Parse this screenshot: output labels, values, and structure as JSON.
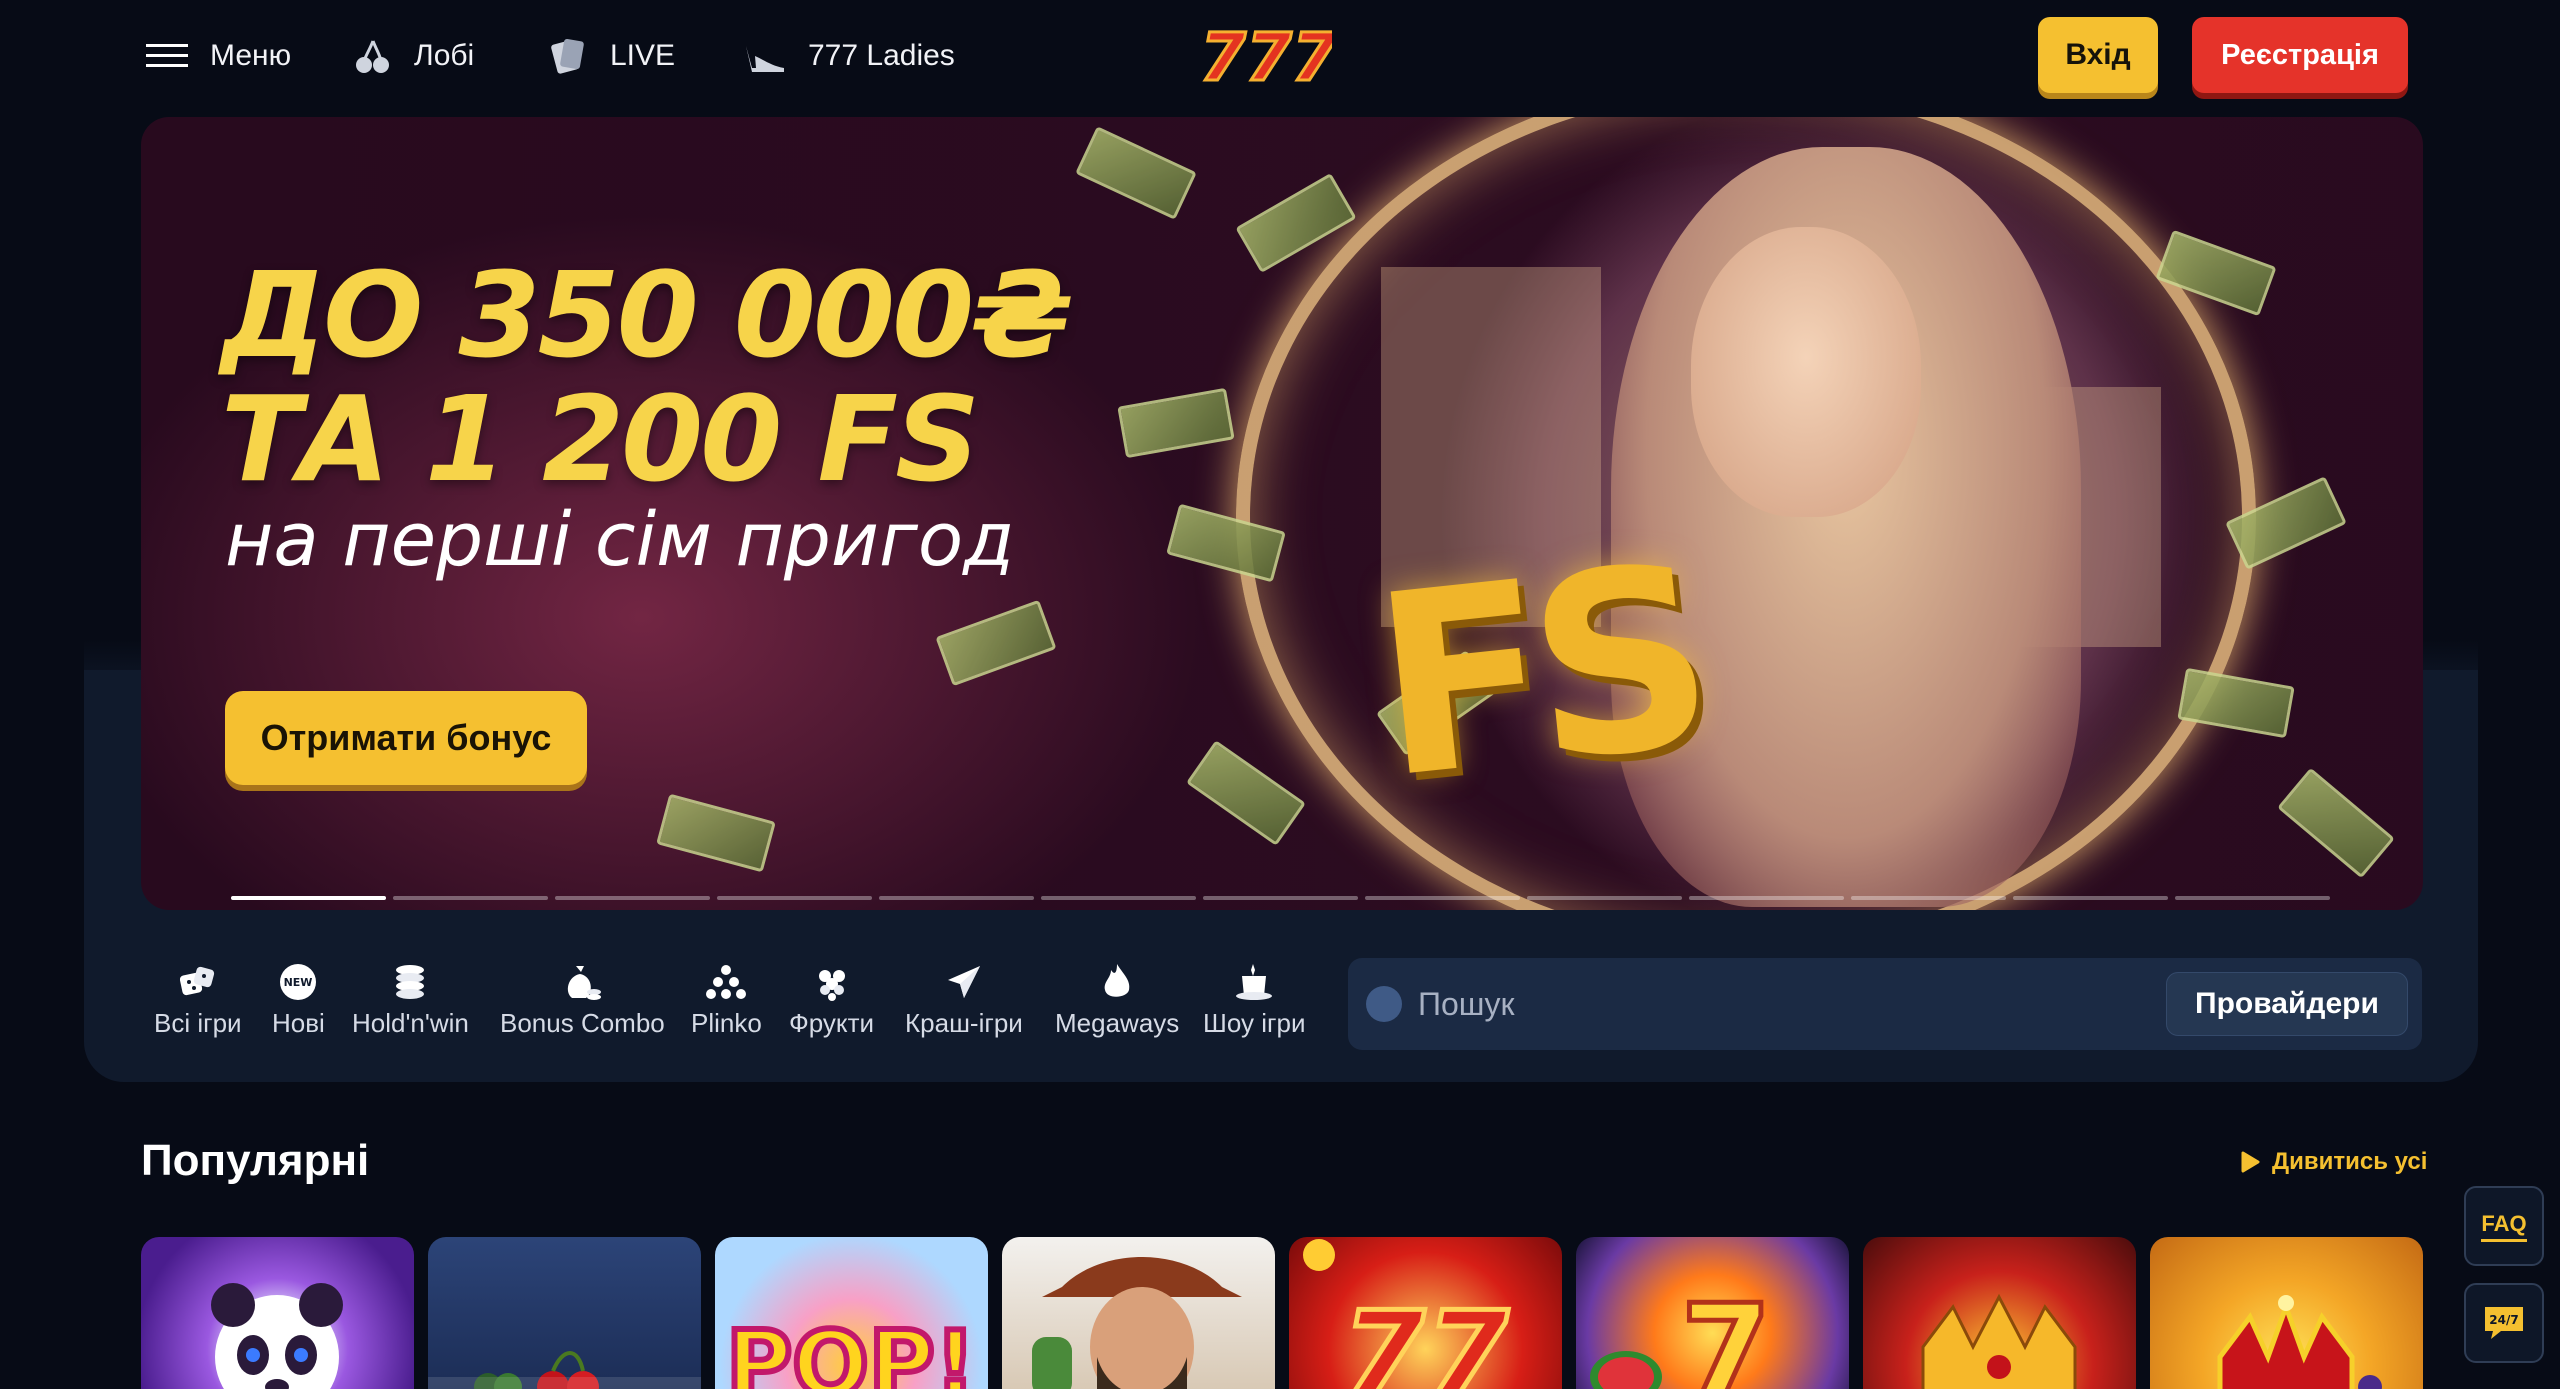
{
  "header": {
    "menu_label": "Меню",
    "lobby_label": "Лобі",
    "live_label": "LIVE",
    "ladies_label": "777 Ladies",
    "logo_text": "777",
    "login_label": "Вхід",
    "register_label": "Реєстрація"
  },
  "hero": {
    "title_line1": "ДО 350 000₴",
    "title_line2": "ТА 1 200 FS",
    "subtitle": "на перші сім пригод",
    "fs_text": "FS",
    "cta_label": "Отримати бонус",
    "slide_count": 13,
    "active_slide": 1
  },
  "categories": [
    {
      "label": "Всі ігри",
      "icon": "dice-icon"
    },
    {
      "label": "Нові",
      "icon": "new-badge-icon"
    },
    {
      "label": "Hold'n'win",
      "icon": "coins-stack-icon"
    },
    {
      "label": "Bonus Combo",
      "icon": "money-bag-icon"
    },
    {
      "label": "Plinko",
      "icon": "plinko-icon"
    },
    {
      "label": "Фрукти",
      "icon": "grapes-icon"
    },
    {
      "label": "Краш-ігри",
      "icon": "airplane-icon"
    },
    {
      "label": "Megaways",
      "icon": "flame-icon"
    },
    {
      "label": "Шоу ігри",
      "icon": "top-hat-icon"
    }
  ],
  "search": {
    "placeholder": "Пошук",
    "providers_label": "Провайдери"
  },
  "popular": {
    "title": "Популярні",
    "view_all_label": "Дивитись усі"
  },
  "side": {
    "faq_label": "FAQ",
    "support_label": "24/7"
  },
  "colors": {
    "accent_yellow": "#f5c030",
    "register_red": "#e5332a",
    "background": "#070b16",
    "panel": "#101a2c"
  }
}
